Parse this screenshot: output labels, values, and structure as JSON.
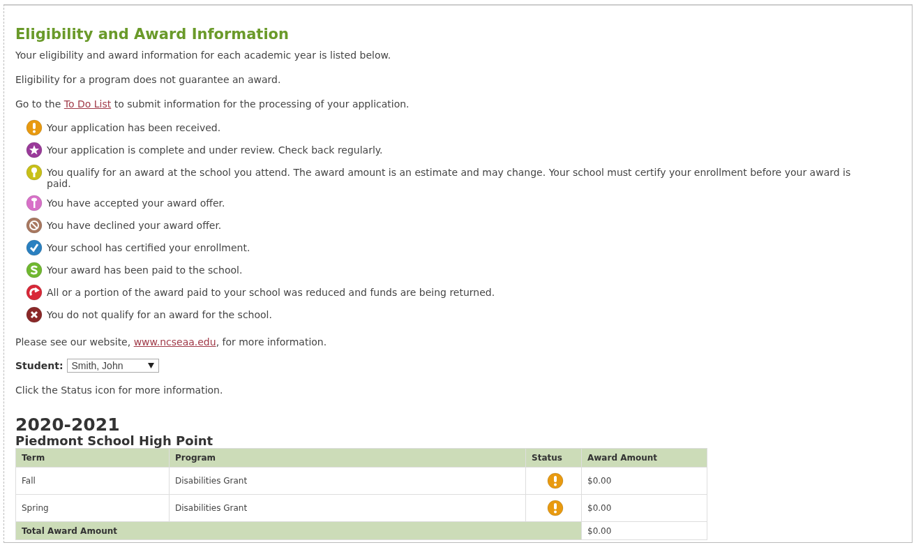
{
  "title": "Eligibility and Award Information",
  "intro": [
    "Your eligibility and award information for each academic year is listed below.",
    "Eligibility for a program does not guarantee an award."
  ],
  "todo_line": {
    "before": "Go to the ",
    "link": "To Do List",
    "after": " to submit information for the processing of your application."
  },
  "legend": [
    {
      "kind": "received",
      "color": "#e89a10",
      "text": "Your application has been received."
    },
    {
      "kind": "review",
      "color": "#9a3a9a",
      "text": "Your application is complete and under review. Check back regularly."
    },
    {
      "kind": "qualify",
      "color": "#c8c018",
      "text": "You qualify for an award at the school you attend. The award amount is an estimate and may change. Your school must certify your enrollment before your award is paid."
    },
    {
      "kind": "accepted",
      "color": "#d870c8",
      "text": "You have accepted your award offer."
    },
    {
      "kind": "declined",
      "color": "#a87860",
      "text": "You have declined your award offer."
    },
    {
      "kind": "certified",
      "color": "#2a80c0",
      "text": "Your school has certified your enrollment."
    },
    {
      "kind": "paid",
      "color": "#70b830",
      "text": "Your award has been paid to the school."
    },
    {
      "kind": "returned",
      "color": "#d82838",
      "text": "All or a portion of the award paid to your school was reduced and funds are being returned."
    },
    {
      "kind": "not_qualify",
      "color": "#8a2828",
      "text": "You do not qualify for an award for the school."
    }
  ],
  "website_line": {
    "before": "Please see our website, ",
    "link": "www.ncseaa.edu",
    "after": ", for more information."
  },
  "student": {
    "label": "Student:",
    "value": "Smith, John"
  },
  "status_hint": "Click the Status icon for more information.",
  "year": "2020-2021",
  "school": "Piedmont School High Point",
  "table": {
    "columns": [
      "Term",
      "Program",
      "Status",
      "Award Amount"
    ],
    "rows": [
      {
        "term": "Fall",
        "program": "Disabilities Grant",
        "status": {
          "kind": "received",
          "color": "#e89a10"
        },
        "amount": "$0.00"
      },
      {
        "term": "Spring",
        "program": "Disabilities Grant",
        "status": {
          "kind": "received",
          "color": "#e89a10"
        },
        "amount": "$0.00"
      }
    ],
    "total": {
      "label": "Total Award Amount",
      "amount": "$0.00"
    }
  }
}
